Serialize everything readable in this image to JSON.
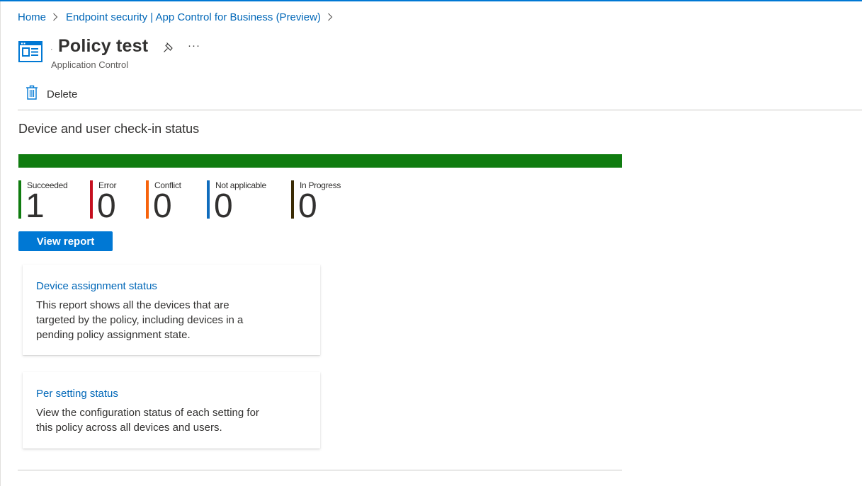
{
  "breadcrumb": [
    "Home",
    "Endpoint security | App Control for Business (Preview)"
  ],
  "header": {
    "title": "Policy test",
    "subtitle": "Application Control",
    "icon": "policy-icon",
    "more": "···"
  },
  "toolbar": {
    "delete_label": "Delete"
  },
  "checkin": {
    "title": "Device and user check-in status",
    "succeeded_fraction": 1.0,
    "stats": [
      {
        "label": "Succeeded",
        "value": "1",
        "color": "#107c10"
      },
      {
        "label": "Error",
        "value": "0",
        "color": "#c50f1f"
      },
      {
        "label": "Conflict",
        "value": "0",
        "color": "#f7630c"
      },
      {
        "label": "Not applicable",
        "value": "0",
        "color": "#0f6cbd"
      },
      {
        "label": "In Progress",
        "value": "0",
        "color": "#3b2c05"
      }
    ],
    "view_report_label": "View report"
  },
  "cards": [
    {
      "title": "Device assignment status",
      "description": "This report shows all the devices that are targeted by the policy, including devices in a pending policy assignment state."
    },
    {
      "title": "Per setting status",
      "description": "View the configuration status of each setting for this policy across all devices and users."
    }
  ]
}
